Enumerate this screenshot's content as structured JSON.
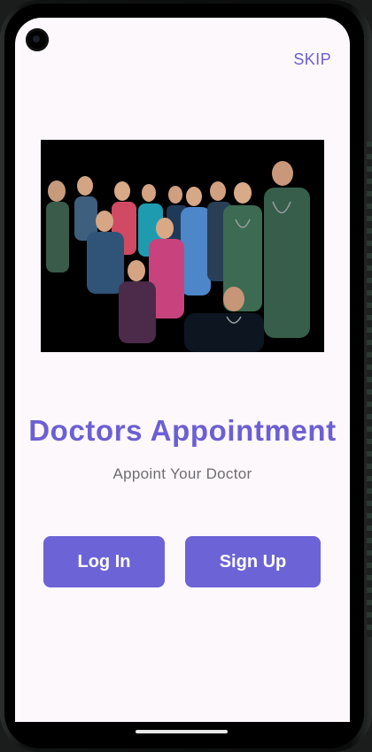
{
  "header": {
    "skip_label": "SKIP"
  },
  "hero": {
    "image_alt": "Group of doctors in scrubs"
  },
  "main": {
    "title": "Doctors Appointment",
    "subtitle": "Appoint Your Doctor"
  },
  "actions": {
    "login_label": "Log In",
    "signup_label": "Sign Up"
  },
  "colors": {
    "accent": "#6c5fd3",
    "button": "#6c63d6",
    "background": "#fdf8fc",
    "subtitle": "#6f6d72"
  }
}
